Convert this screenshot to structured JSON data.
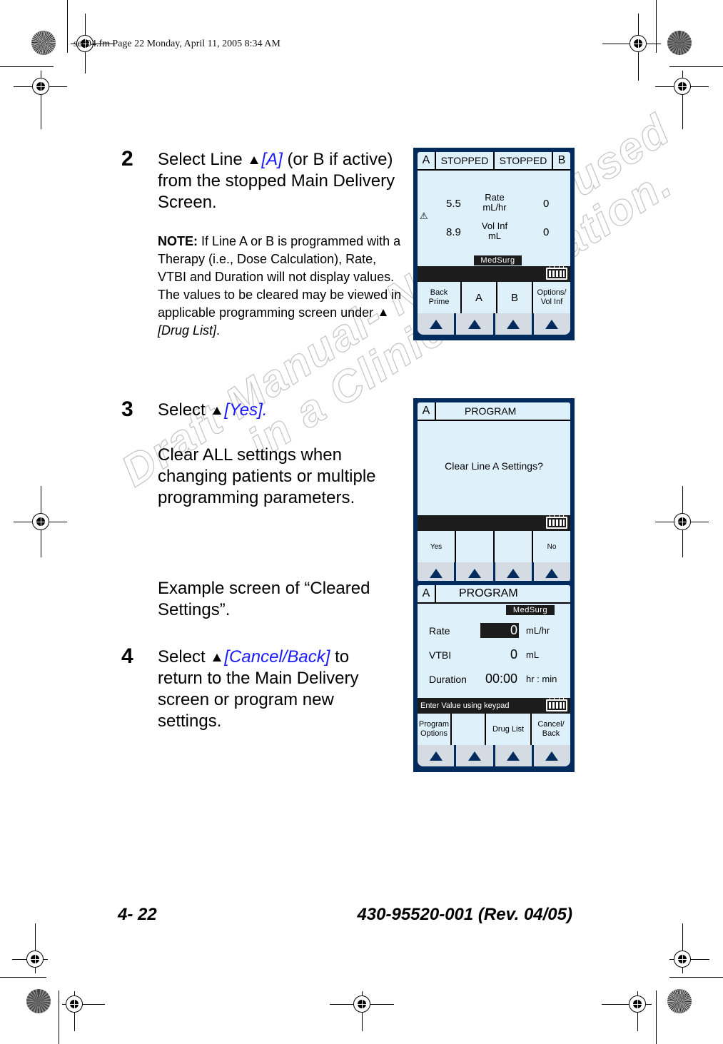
{
  "print_header": "sec04.fm  Page 22  Monday, April 11, 2005  8:34 AM",
  "watermark": {
    "line1": "Draft Manual- Not to be used",
    "line2": "in a Clinical Situation."
  },
  "steps": {
    "step2": {
      "number": "2",
      "text_before": "Select Line",
      "link": "[A]",
      "text_after": "(or B if active) from the stopped Main Delivery Screen.",
      "note_label": "NOTE:",
      "note_text": "If Line A or B is programmed with a Therapy (i.e., Dose Calculation), Rate, VTBI and Duration will not display values. The values to be cleared may be viewed in applicable programming screen under",
      "note_link": "[Drug List]",
      "note_end": "."
    },
    "step3": {
      "number": "3",
      "text_before": "Select",
      "link": "[Yes].",
      "para2": "Clear ALL settings when changing patients or multiple programming parameters.",
      "para3": "Example screen of “Cleared Settings”."
    },
    "step4": {
      "number": "4",
      "text_before": "Select",
      "link": "[Cancel/Back]",
      "text_after": "to return to the Main Delivery screen or program new settings."
    }
  },
  "screen1": {
    "line_a": "A",
    "status_a": "STOPPED",
    "status_b": "STOPPED",
    "line_b": "B",
    "rate_a": "5.5",
    "rate_label_1": "Rate",
    "rate_label_2": "mL/hr",
    "rate_b": "0",
    "vol_a": "8.9",
    "vol_label_1": "Vol Inf",
    "vol_label_2": "mL",
    "vol_b": "0",
    "warning_icon": "⚠",
    "care_area": "MedSurg",
    "softkeys": [
      "Back Prime",
      "A",
      "B",
      "Options/ Vol Inf"
    ]
  },
  "screen2": {
    "line": "A",
    "title": "PROGRAM",
    "message": "Clear Line A Settings?",
    "softkeys": [
      "Yes",
      "",
      "",
      "No"
    ]
  },
  "screen3": {
    "line": "A",
    "title": "PROGRAM",
    "care_area": "MedSurg",
    "rows": [
      {
        "label": "Rate",
        "value": "0",
        "unit": "mL/hr"
      },
      {
        "label": "VTBI",
        "value": "0",
        "unit": "mL"
      },
      {
        "label": "Duration",
        "value": "00:00",
        "unit": "hr : min"
      }
    ],
    "status_message": "Enter Value using keypad",
    "softkeys": [
      "Program Options",
      "",
      "Drug List",
      "Cancel/ Back"
    ]
  },
  "footer": {
    "page_number": "4- 22",
    "doc_number": "430-95520-001 (Rev. 04/05)"
  },
  "colors": {
    "device_frame": "#002b5c",
    "screen_bg": "#def1fb",
    "link": "#1a1aff"
  }
}
